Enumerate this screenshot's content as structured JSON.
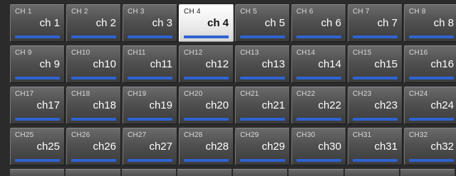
{
  "channel_grid": {
    "selected": "CH 4",
    "bar_color": "#2f63d0",
    "rows": [
      [
        {
          "id": "CH 1",
          "name": "ch 1"
        },
        {
          "id": "CH 2",
          "name": "ch 2"
        },
        {
          "id": "CH 3",
          "name": "ch 3"
        },
        {
          "id": "CH 4",
          "name": "ch 4"
        },
        {
          "id": "CH 5",
          "name": "ch 5"
        },
        {
          "id": "CH 6",
          "name": "ch 6"
        },
        {
          "id": "CH 7",
          "name": "ch 7"
        },
        {
          "id": "CH 8",
          "name": "ch 8"
        }
      ],
      [
        {
          "id": "CH 9",
          "name": "ch 9"
        },
        {
          "id": "CH10",
          "name": "ch10"
        },
        {
          "id": "CH11",
          "name": "ch11"
        },
        {
          "id": "CH12",
          "name": "ch12"
        },
        {
          "id": "CH13",
          "name": "ch13"
        },
        {
          "id": "CH14",
          "name": "ch14"
        },
        {
          "id": "CH15",
          "name": "ch15"
        },
        {
          "id": "CH16",
          "name": "ch16"
        }
      ],
      [
        {
          "id": "CH17",
          "name": "ch17"
        },
        {
          "id": "CH18",
          "name": "ch18"
        },
        {
          "id": "CH19",
          "name": "ch19"
        },
        {
          "id": "CH20",
          "name": "ch20"
        },
        {
          "id": "CH21",
          "name": "ch21"
        },
        {
          "id": "CH22",
          "name": "ch22"
        },
        {
          "id": "CH23",
          "name": "ch23"
        },
        {
          "id": "CH24",
          "name": "ch24"
        }
      ],
      [
        {
          "id": "CH25",
          "name": "ch25"
        },
        {
          "id": "CH26",
          "name": "ch26"
        },
        {
          "id": "CH27",
          "name": "ch27"
        },
        {
          "id": "CH28",
          "name": "ch28"
        },
        {
          "id": "CH29",
          "name": "ch29"
        },
        {
          "id": "CH30",
          "name": "ch30"
        },
        {
          "id": "CH31",
          "name": "ch31"
        },
        {
          "id": "CH32",
          "name": "ch32"
        }
      ]
    ]
  }
}
